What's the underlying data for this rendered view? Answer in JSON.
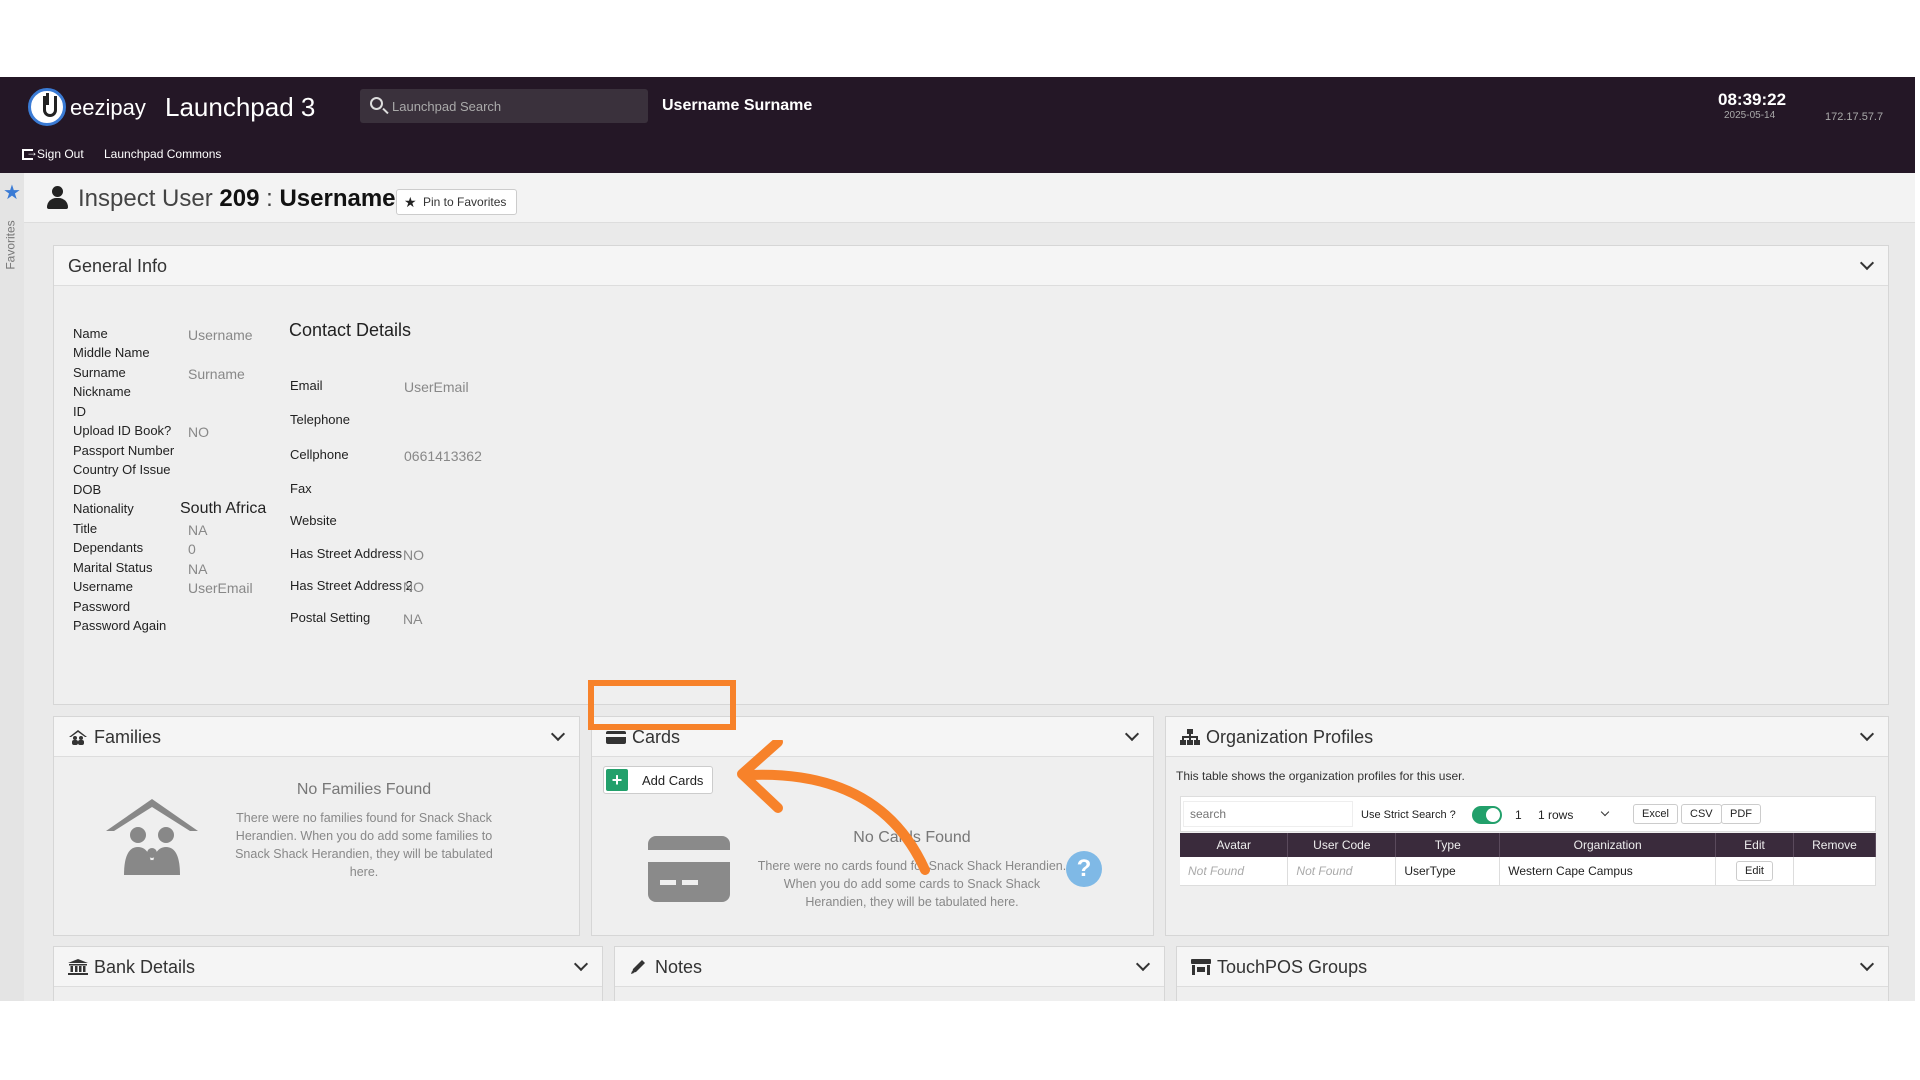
{
  "header": {
    "brand": "eezipay",
    "app_title": "Launchpad 3",
    "search_placeholder": "Launchpad Search",
    "user": "Username Surname",
    "time": "08:39:22",
    "date": "2025-05-14",
    "ip": "172.17.57.7",
    "sign_out": "Sign Out",
    "commons": "Launchpad Commons"
  },
  "sidebar": {
    "favorites_label": "Favorites"
  },
  "page": {
    "title_prefix": "Inspect User",
    "user_id": "209",
    "separator": ":",
    "username": "Username",
    "pin_label": "Pin to Favorites"
  },
  "general_info": {
    "title": "General Info",
    "fields": [
      {
        "label": "Name",
        "value": "Username"
      },
      {
        "label": "Middle Name",
        "value": ""
      },
      {
        "label": "Surname",
        "value": "Surname"
      },
      {
        "label": "Nickname",
        "value": ""
      },
      {
        "label": "ID",
        "value": ""
      },
      {
        "label": "Upload ID Book?",
        "value": "NO"
      },
      {
        "label": "Passport Number",
        "value": ""
      },
      {
        "label": "Country Of Issue",
        "value": ""
      },
      {
        "label": "DOB",
        "value": ""
      },
      {
        "label": "Nationality",
        "value": "South Africa"
      },
      {
        "label": "Title",
        "value": "NA"
      },
      {
        "label": "Dependants",
        "value": "0"
      },
      {
        "label": "Marital Status",
        "value": "NA"
      },
      {
        "label": "Username",
        "value": "UserEmail"
      },
      {
        "label": "Password",
        "value": ""
      },
      {
        "label": "Password Again",
        "value": ""
      }
    ],
    "contact_title": "Contact Details",
    "contact": [
      {
        "label": "Email",
        "value": "UserEmail"
      },
      {
        "label": "Telephone",
        "value": ""
      },
      {
        "label": "Cellphone",
        "value": "0661413362"
      },
      {
        "label": "Fax",
        "value": ""
      },
      {
        "label": "Website",
        "value": ""
      },
      {
        "label": "Has Street Address",
        "value": "NO"
      },
      {
        "label": "Has Street Address 2",
        "value": "NO"
      },
      {
        "label": "Postal Setting",
        "value": "NA"
      }
    ]
  },
  "families": {
    "title": "Families",
    "empty_title": "No Families Found",
    "empty_text": "There were no families found for Snack Shack Herandien. When you do add some families to Snack Shack Herandien, they will be tabulated here."
  },
  "cards": {
    "title": "Cards",
    "add_label": "Add Cards",
    "empty_title": "No Cards Found",
    "empty_text": "There were no cards found for Snack Shack Herandien. When you do add some cards to Snack Shack Herandien, they will be tabulated here.",
    "help": "?"
  },
  "org_profiles": {
    "title": "Organization Profiles",
    "description": "This table shows the organization profiles for this user.",
    "search_placeholder": "search",
    "strict_label": "Use Strict Search ?",
    "page": "1",
    "rows_option": "1 rows",
    "export": [
      "Excel",
      "CSV",
      "PDF"
    ],
    "columns": [
      "Avatar",
      "User Code",
      "Type",
      "Organization",
      "Edit",
      "Remove"
    ],
    "rows": [
      {
        "avatar": "Not Found",
        "user_code": "Not Found",
        "type": "UserType",
        "organization": "Western Cape Campus",
        "edit": "Edit",
        "remove": ""
      }
    ]
  },
  "bank": {
    "title": "Bank Details"
  },
  "notes": {
    "title": "Notes"
  },
  "touchpos": {
    "title": "TouchPOS Groups"
  },
  "colors": {
    "header": "#241726",
    "accent": "#3a7bd5",
    "annotation": "#f7822a",
    "add_green": "#22a06b"
  }
}
